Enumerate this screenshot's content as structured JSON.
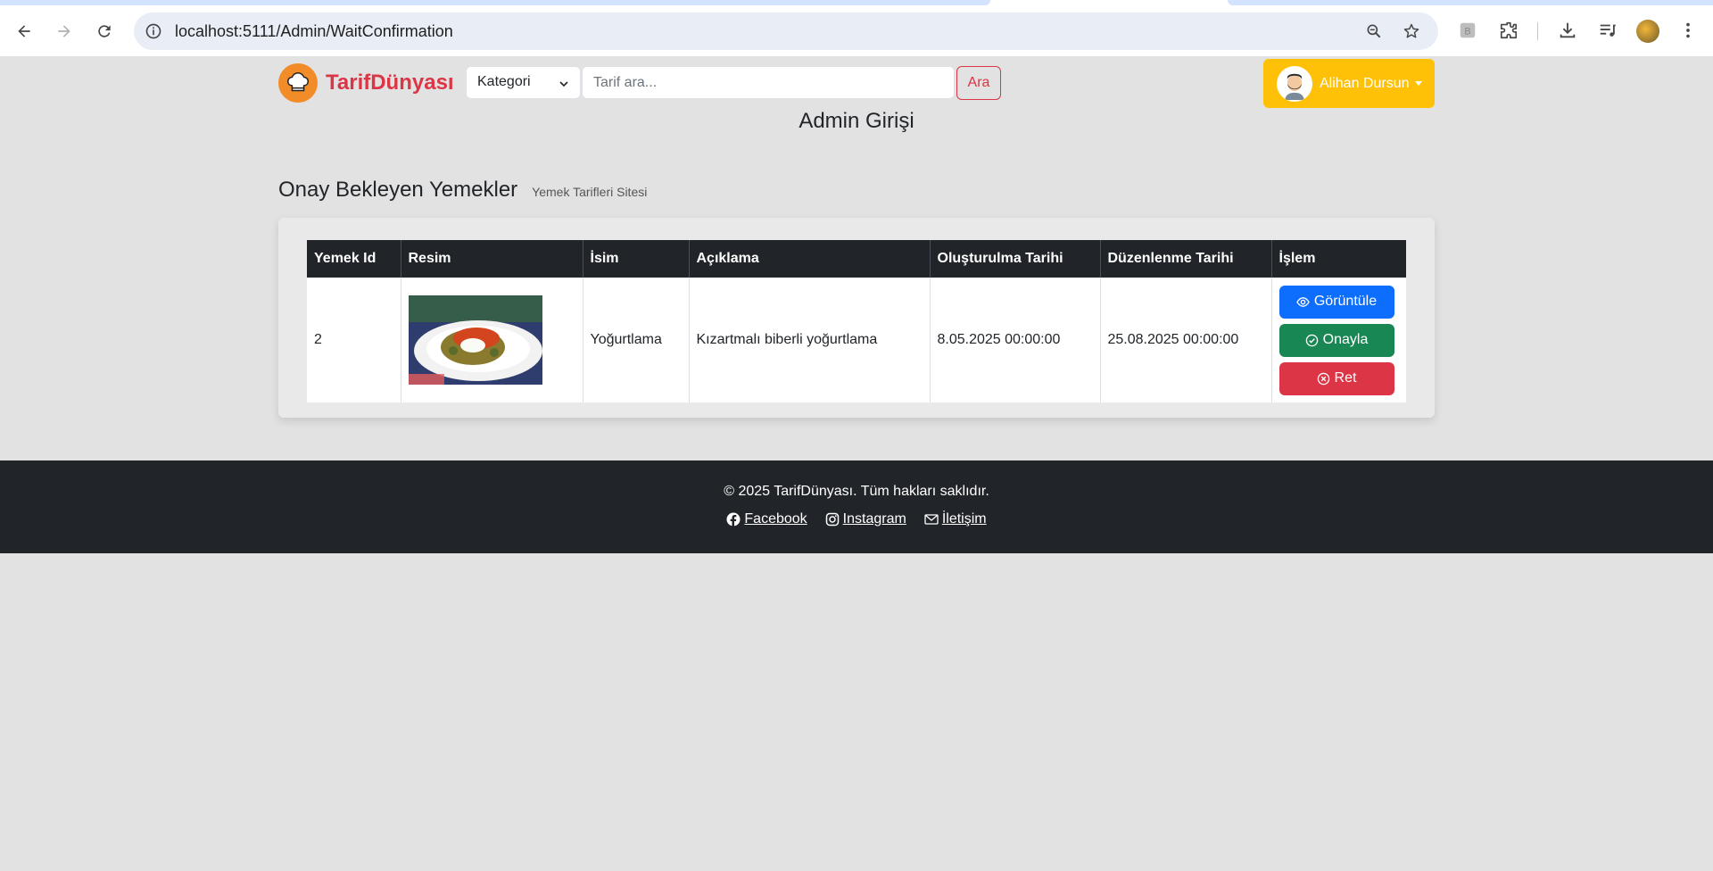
{
  "browser": {
    "url": "localhost:5111/Admin/WaitConfirmation"
  },
  "header": {
    "brand": "TarifDünyası",
    "category_select": "Kategori",
    "search_placeholder": "Tarif ara...",
    "search_button": "Ara",
    "user_name": "Alihan Dursun"
  },
  "admin_title": "Admin Girişi",
  "page": {
    "title": "Onay Bekleyen Yemekler",
    "subtitle": "Yemek Tarifleri Sitesi"
  },
  "table": {
    "columns": [
      "Yemek Id",
      "Resim",
      "İsim",
      "Açıklama",
      "Oluşturulma Tarihi",
      "Düzenlenme Tarihi",
      "İşlem"
    ],
    "rows": [
      {
        "id": "2",
        "name": "Yoğurtlama",
        "description": "Kızartmalı biberli yoğurtlama",
        "created": "8.05.2025 00:00:00",
        "updated": "25.08.2025 00:00:00"
      }
    ],
    "actions": {
      "view": "Görüntüle",
      "approve": "Onayla",
      "reject": "Ret"
    }
  },
  "footer": {
    "copyright": "© 2025 TarifDünyası. Tüm hakları saklıdır.",
    "facebook": " Facebook",
    "instagram": " Instagram",
    "contact": " İletişim"
  },
  "colors": {
    "brand_red": "#dc3545",
    "user_button": "#ffc107",
    "view_button": "#0d6efd",
    "approve_button": "#198754",
    "reject_button": "#dc3545",
    "footer_bg": "#212529"
  }
}
